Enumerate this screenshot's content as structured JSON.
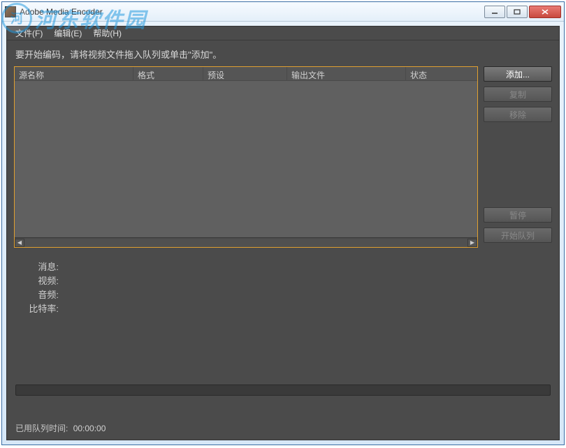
{
  "window": {
    "title": "Adobe Media Encoder"
  },
  "menu": {
    "file": "文件(F)",
    "edit": "编辑(E)",
    "help": "帮助(H)"
  },
  "instruction_text": "要开始编码，请将视频文件拖入队列或单击\"添加\"。",
  "columns": {
    "source": "源名称",
    "format": "格式",
    "preset": "预设",
    "output": "输出文件",
    "status": "状态"
  },
  "buttons": {
    "add": "添加...",
    "duplicate": "复制",
    "remove": "移除",
    "pause": "暂停",
    "start_queue": "开始队列"
  },
  "info": {
    "message_label": "消息:",
    "video_label": "视频:",
    "audio_label": "音频:",
    "bitrate_label": "比特率:"
  },
  "footer": {
    "elapsed_label": "已用队列时间:",
    "elapsed_value": "00:00:00"
  },
  "watermark": {
    "logo_text": "河",
    "text": "河东软件园"
  }
}
